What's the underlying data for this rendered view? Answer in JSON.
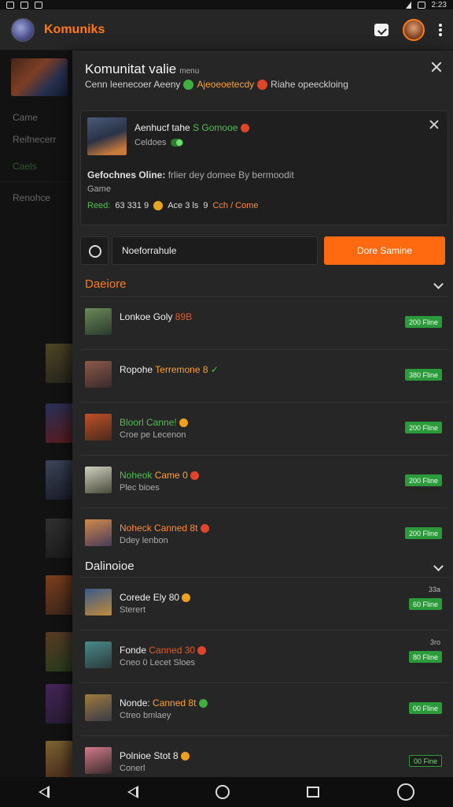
{
  "statusbar": {
    "time": "2:23"
  },
  "appbar": {
    "title": "Komuniks"
  },
  "sidebar": {
    "item1": "Came",
    "item2": "Reifnecerr",
    "item3": "Caels",
    "item4": "Renohce"
  },
  "panel": {
    "title": "Komunitat valie",
    "title_small": "menu",
    "subtitle_a": "Cenn leenecoer Aeeny",
    "subtitle_b": "Ajeoeoetecdy",
    "subtitle_c": "Riahe opeeckloing",
    "card": {
      "name_prefix": "Aenhucf tahe",
      "name_highlight": "S Gomooe",
      "status": "Celdoes",
      "desc_bold": "Gefochnes Oline:",
      "desc_rest": "frlier dey domee By bermoodit",
      "desc2": "Game",
      "stats_label": "Reed:",
      "stats_values": "63 331 9",
      "stats_mid": "Ace 3 ls",
      "stats_end": "9",
      "stats_orange": "Cch / Come"
    },
    "search": {
      "input_value": "Noeforrahule",
      "button_label": "Dore Samine"
    },
    "section1": {
      "title": "Daeiore",
      "rows": [
        {
          "title": "Lonkoe Goly",
          "title_tag": "89B",
          "sub": "",
          "badge": "200 Fline"
        },
        {
          "title": "Ropohe",
          "title_tag": "Terremone 8",
          "sub": "",
          "badge": "380 Fline"
        },
        {
          "title": "Bloorl Canne!",
          "title_tag": "",
          "sub": "Croe pe Lecenon",
          "badge": "200 Fline"
        },
        {
          "title": "Noheok",
          "title_tag": "Came 0",
          "sub": "Plec bioes",
          "badge": "200 Fline"
        },
        {
          "title": "Noheck Canned 8t",
          "title_tag": "",
          "sub": "Ddey lenbon",
          "badge": "200 Fline"
        }
      ]
    },
    "section2": {
      "title": "Dalinoioe",
      "rows": [
        {
          "title": "Corede Ely 80",
          "sub": "Sterert",
          "meta": "33a",
          "badge": "60 Fline"
        },
        {
          "title": "Fonde",
          "title_tag": "Canned 30",
          "sub": "Cneo 0 Lecet Sloes",
          "meta": "3ro",
          "badge": "80 Fline"
        },
        {
          "title": "Nonde:",
          "title_tag": "Canned 8t",
          "sub": "Ctreo bmlaey",
          "meta": "",
          "badge": "00 Fline"
        },
        {
          "title": "Polnioe Stot 8",
          "sub": "Conerl",
          "meta": "",
          "badge": "00 Fine"
        }
      ]
    }
  }
}
